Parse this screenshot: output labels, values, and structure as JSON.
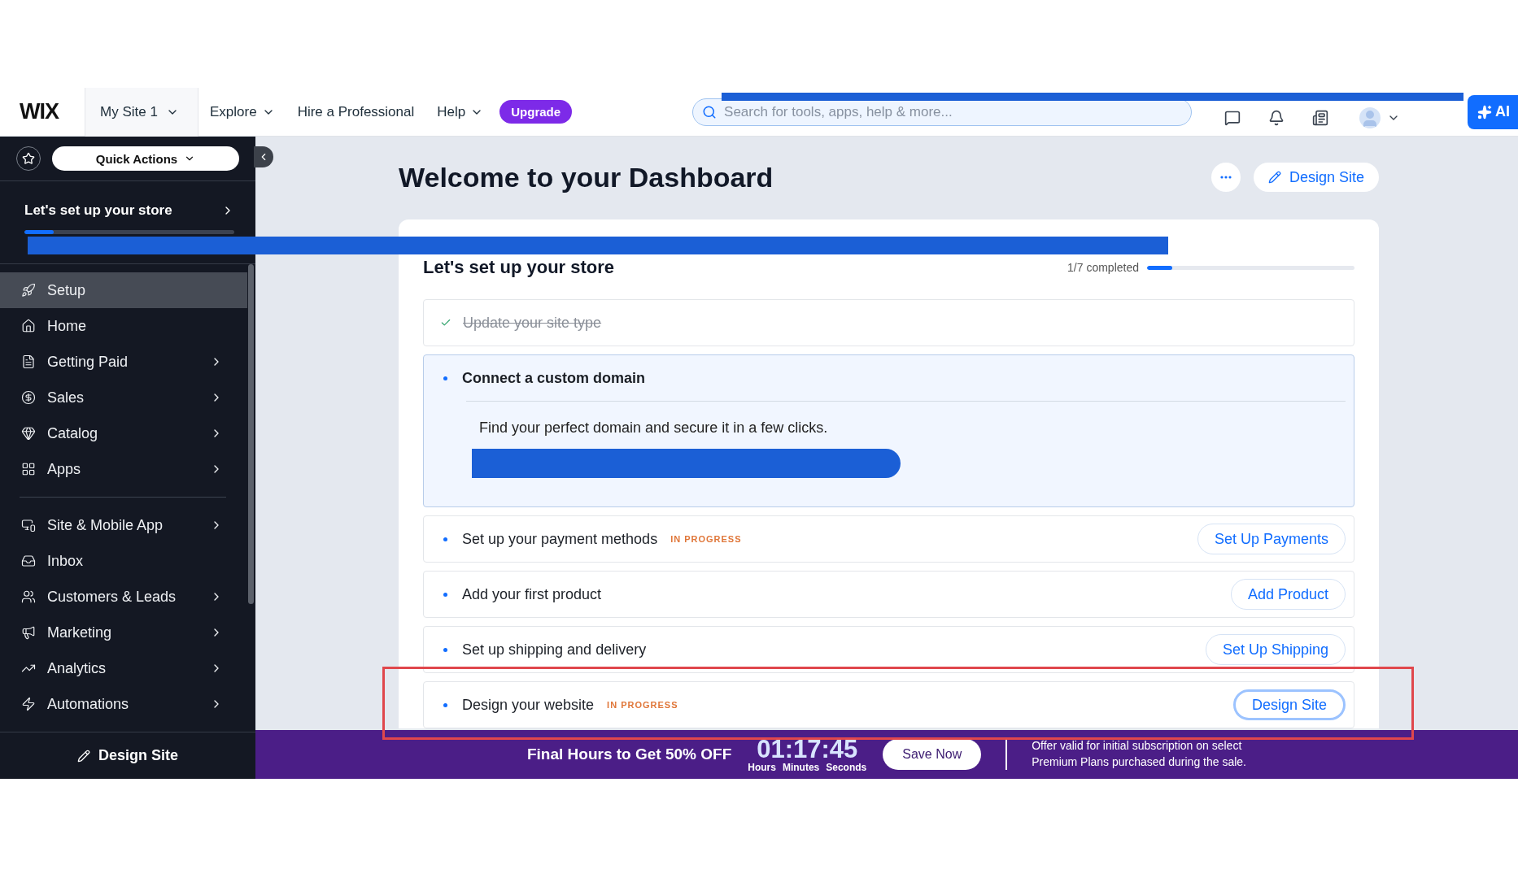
{
  "topbar": {
    "logo": "WIX",
    "site": "My Site 1",
    "nav": [
      {
        "label": "Explore",
        "dropdown": true
      },
      {
        "label": "Hire a Professional",
        "dropdown": false
      },
      {
        "label": "Help",
        "dropdown": true
      }
    ],
    "upgrade": "Upgrade",
    "search": {
      "placeholder": "Search for tools, apps, help & more..."
    },
    "ai": "AI"
  },
  "sidebar": {
    "quick_actions": "Quick Actions",
    "setup_card": {
      "title": "Let's set up your store",
      "level": 0.14
    },
    "groups": [
      [
        {
          "label": "Setup",
          "selected": true,
          "submenu": false
        },
        {
          "label": "Home",
          "selected": false,
          "submenu": false
        },
        {
          "label": "Getting Paid",
          "selected": false,
          "submenu": true
        },
        {
          "label": "Sales",
          "selected": false,
          "submenu": true
        },
        {
          "label": "Catalog",
          "selected": false,
          "submenu": true
        },
        {
          "label": "Apps",
          "selected": false,
          "submenu": true
        }
      ],
      [
        {
          "label": "Site & Mobile App",
          "selected": false,
          "submenu": true
        },
        {
          "label": "Inbox",
          "selected": false,
          "submenu": false
        },
        {
          "label": "Customers & Leads",
          "selected": false,
          "submenu": true
        },
        {
          "label": "Marketing",
          "selected": false,
          "submenu": true
        },
        {
          "label": "Analytics",
          "selected": false,
          "submenu": true
        },
        {
          "label": "Automations",
          "selected": false,
          "submenu": true
        }
      ]
    ],
    "design_button": "Design Site"
  },
  "main": {
    "title": "Welcome to your Dashboard",
    "design_button": "Design Site",
    "card": {
      "title": "Let's set up your store",
      "progress_text": "1/7 completed",
      "level": 0.12,
      "tasks": [
        {
          "title": "Update your site type",
          "done": true,
          "expanded": false
        },
        {
          "title": "Connect a custom domain",
          "done": false,
          "expanded": true,
          "description": "Find your perfect domain and secure it in a few clicks."
        },
        {
          "title": "Set up your payment methods",
          "done": false,
          "expanded": false,
          "badge": "IN PROGRESS",
          "button": "Set Up Payments",
          "focused": false
        },
        {
          "title": "Add your first product",
          "done": false,
          "expanded": false,
          "button": "Add Product",
          "focused": false
        },
        {
          "title": "Set up shipping and delivery",
          "done": false,
          "expanded": false,
          "button": "Set Up Shipping",
          "focused": false
        },
        {
          "title": "Design your website",
          "done": false,
          "expanded": false,
          "badge": "IN PROGRESS",
          "button": "Design Site",
          "focused": true
        }
      ]
    }
  },
  "banner": {
    "headline": "Final Hours to Get 50% OFF",
    "timer": "01:17:45",
    "units": [
      "Hours",
      "Minutes",
      "Seconds"
    ],
    "button": "Save Now",
    "note": [
      "Offer valid for initial subscription on select",
      "Premium Plans purchased during the sale."
    ]
  }
}
